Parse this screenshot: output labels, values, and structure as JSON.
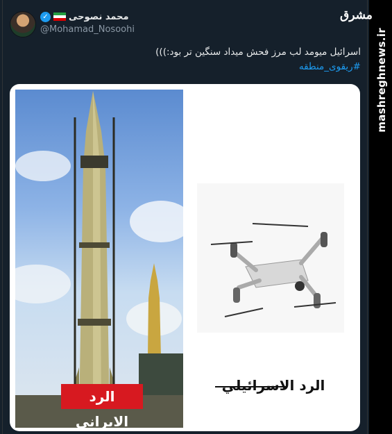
{
  "tweet": {
    "display_name": "محمد نصوحی",
    "handle": "@Mohamad_Nosoohi",
    "text": "اسرائیل میومد لب مرز فحش میداد سنگین تر بود:)))",
    "hashtag": "#ریقوی_منطقه"
  },
  "watermark": {
    "site": "mashreghnews.ir",
    "logo": "مشرق"
  },
  "media": {
    "left_label": "الرد الايراني",
    "right_label": "الرد الاسرائيلي"
  },
  "colors": {
    "background": "#15202b",
    "verified": "#1d9bf0",
    "hashtag": "#1d9bf0",
    "iran_label_bg": "#d71920"
  }
}
